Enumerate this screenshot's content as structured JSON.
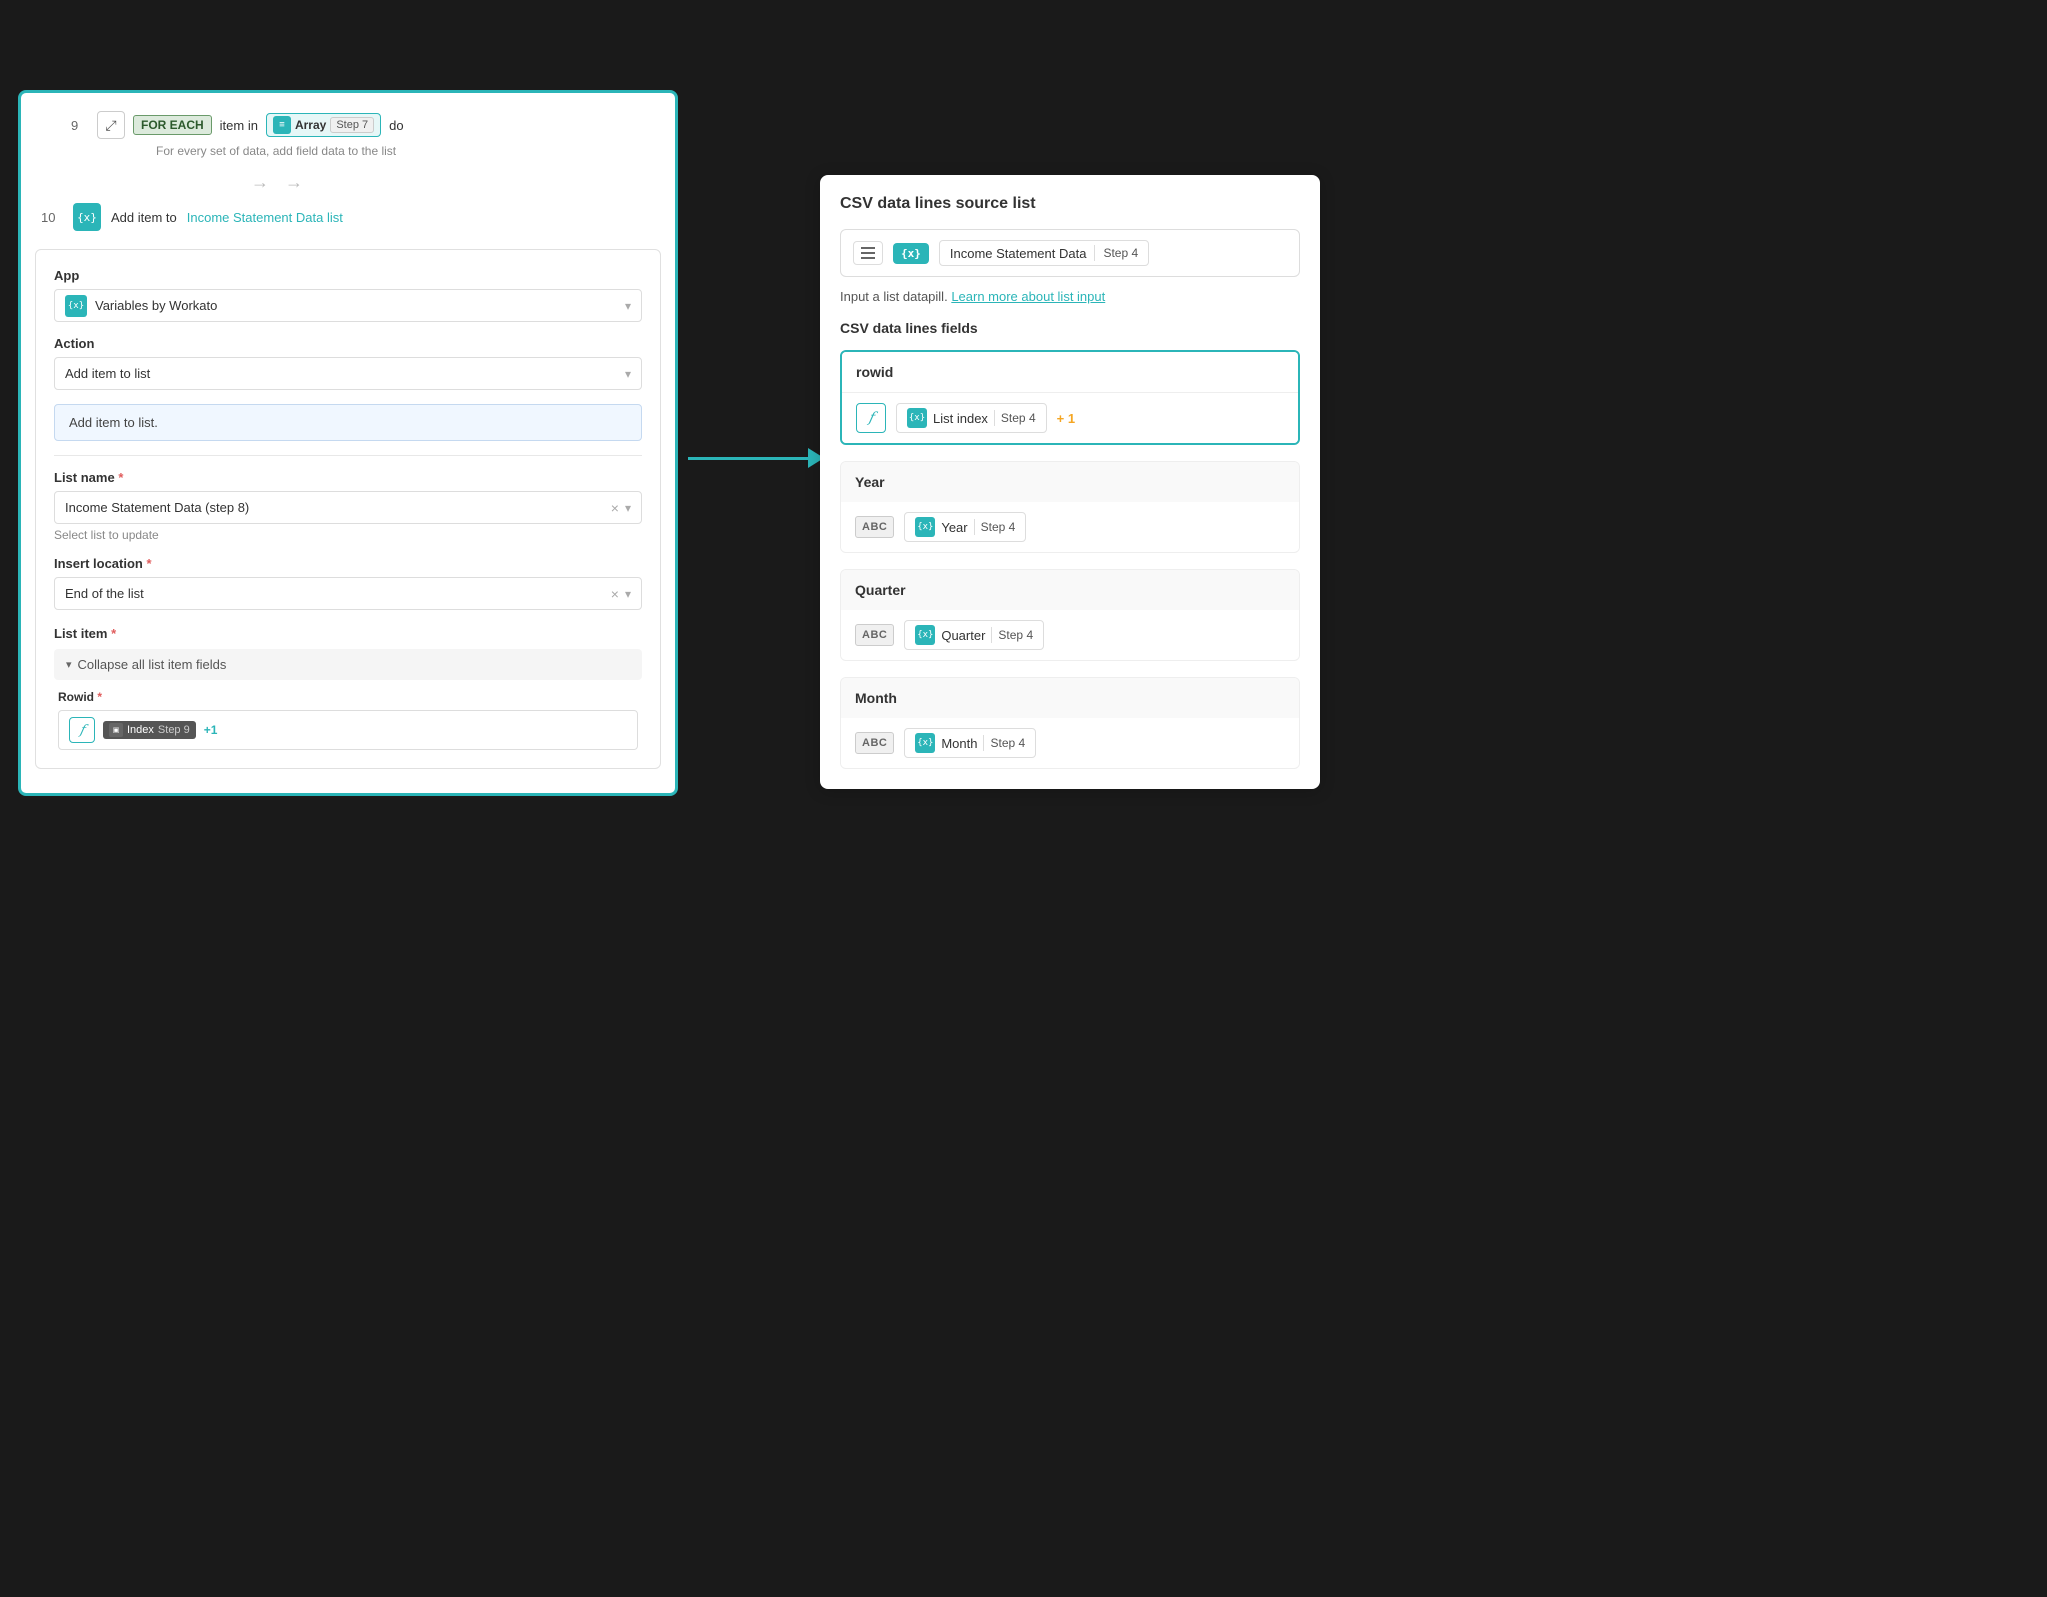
{
  "background": "#1a1a1a",
  "left_panel": {
    "workflow": {
      "step_number": "9",
      "foreach_badge": "FOR EACH",
      "foreach_text_before": "item in",
      "array_label": "Array",
      "step_tag": "Step 7",
      "foreach_text_after": "do",
      "subtitle": "For every set of data, add field data to the list",
      "step10_number": "10",
      "step10_action": "Add item to",
      "step10_link": "Income Statement Data list"
    },
    "form": {
      "app_label": "App",
      "app_icon": "{x}",
      "app_value": "Variables by Workato",
      "action_label": "Action",
      "action_value": "Add item to list",
      "action_description": "Add item to list.",
      "list_name_label": "List name",
      "list_name_required": true,
      "list_name_value": "Income Statement Data (step 8)",
      "list_name_hint": "Select list to update",
      "insert_location_label": "Insert location",
      "insert_location_required": true,
      "insert_location_value": "End of the list",
      "list_item_label": "List item",
      "list_item_required": true,
      "collapse_label": "Collapse all list item fields",
      "rowid_label": "Rowid",
      "rowid_required": true,
      "rowid_pill_label": "Index",
      "rowid_step": "Step 9",
      "rowid_plus": "+1"
    }
  },
  "right_panel": {
    "title": "CSV data lines source list",
    "source_icon": "≡",
    "source_name": "Income Statement Data",
    "source_step": "Step 4",
    "input_hint": "Input a list datapill.",
    "learn_link": "Learn more about list input",
    "fields_title": "CSV data lines fields",
    "fields": [
      {
        "name": "rowid",
        "type": "fx",
        "highlighted": true,
        "pill_label": "List index",
        "pill_step": "Step 4",
        "plus": "+ 1"
      },
      {
        "name": "Year",
        "type": "abc",
        "highlighted": false,
        "pill_label": "Year",
        "pill_step": "Step 4",
        "plus": null
      },
      {
        "name": "Quarter",
        "type": "abc",
        "highlighted": false,
        "pill_label": "Quarter",
        "pill_step": "Step 4",
        "plus": null
      },
      {
        "name": "Month",
        "type": "abc",
        "highlighted": false,
        "pill_label": "Month",
        "pill_step": "Step 4",
        "plus": null
      }
    ]
  }
}
